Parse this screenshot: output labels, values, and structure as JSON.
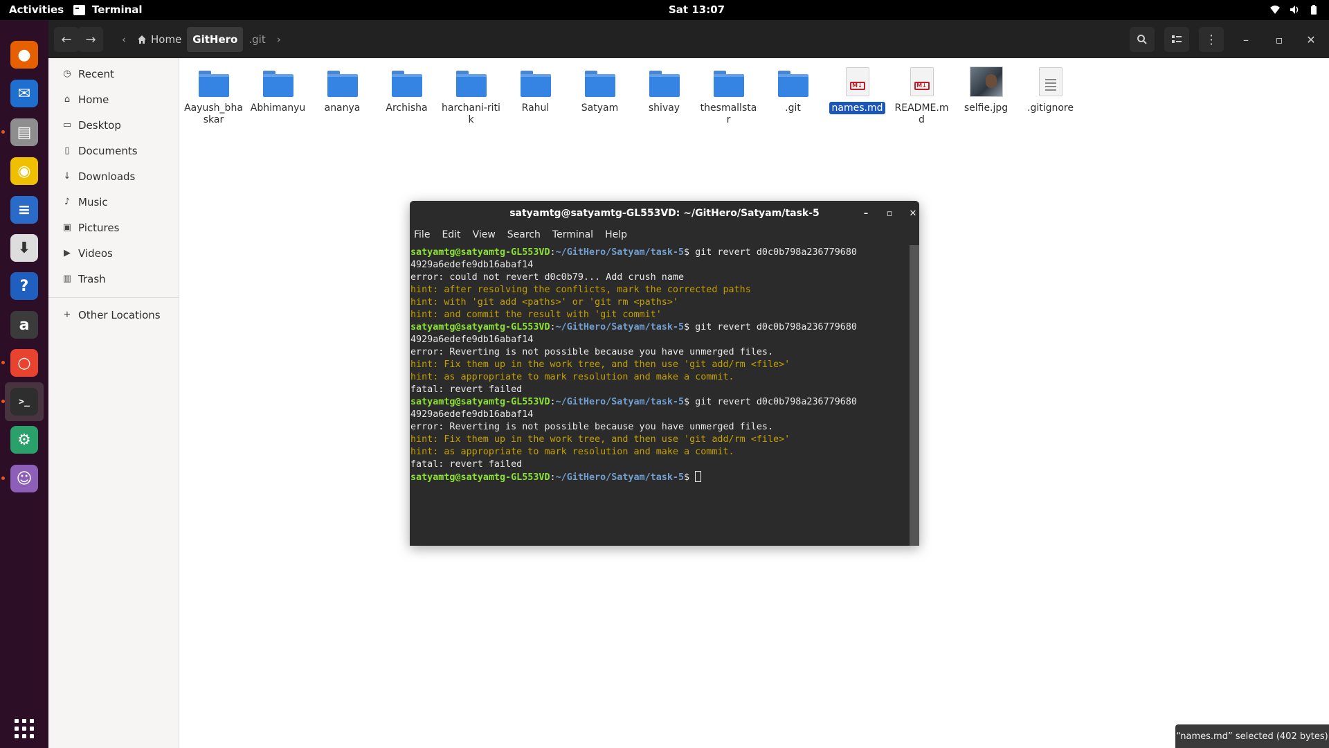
{
  "topbar": {
    "activities": "Activities",
    "app_name": "Terminal",
    "clock": "Sat 13:07"
  },
  "dock": {
    "items": [
      {
        "name": "firefox",
        "icon": "firefox-icon",
        "color": "#e66000"
      },
      {
        "name": "thunderbird",
        "icon": "thunderbird-icon",
        "color": "#1f6fd1"
      },
      {
        "name": "files",
        "icon": "files-icon",
        "color": "#8e8e8e"
      },
      {
        "name": "rhythmbox",
        "icon": "rhythmbox-icon",
        "color": "#f0c000"
      },
      {
        "name": "writer",
        "icon": "writer-icon",
        "color": "#2a6bc9"
      },
      {
        "name": "software",
        "icon": "software-icon",
        "color": "#dddddd"
      },
      {
        "name": "help",
        "icon": "help-icon",
        "color": "#1e5fbf"
      },
      {
        "name": "amazon",
        "icon": "amazon-icon",
        "color": "#3b3b3b"
      },
      {
        "name": "startup-disk",
        "icon": "startup-disk-icon",
        "color": "#e8432e"
      },
      {
        "name": "terminal",
        "icon": "terminal-icon",
        "color": "#2e2e2e"
      },
      {
        "name": "settings",
        "icon": "settings-icon",
        "color": "#2aa06a"
      },
      {
        "name": "gitkraken",
        "icon": "purple-app-icon",
        "color": "#8e5fb8"
      }
    ]
  },
  "files": {
    "path": [
      "Home",
      "GitHero",
      ".git"
    ],
    "sidebar": [
      {
        "label": "Recent",
        "icon": "clock-icon"
      },
      {
        "label": "Home",
        "icon": "home-icon"
      },
      {
        "label": "Desktop",
        "icon": "desktop-icon"
      },
      {
        "label": "Documents",
        "icon": "documents-icon"
      },
      {
        "label": "Downloads",
        "icon": "download-icon"
      },
      {
        "label": "Music",
        "icon": "music-icon"
      },
      {
        "label": "Pictures",
        "icon": "pictures-icon"
      },
      {
        "label": "Videos",
        "icon": "videos-icon"
      },
      {
        "label": "Trash",
        "icon": "trash-icon"
      }
    ],
    "other_locations": "Other Locations",
    "items": [
      {
        "label": "Aayush_bhaskar",
        "type": "folder"
      },
      {
        "label": "Abhimanyu",
        "type": "folder"
      },
      {
        "label": "ananya",
        "type": "folder"
      },
      {
        "label": "Archisha",
        "type": "folder"
      },
      {
        "label": "harchani-ritik",
        "type": "folder"
      },
      {
        "label": "Rahul",
        "type": "folder"
      },
      {
        "label": "Satyam",
        "type": "folder"
      },
      {
        "label": "shivay",
        "type": "folder"
      },
      {
        "label": "thesmallstar",
        "type": "folder"
      },
      {
        "label": ".git",
        "type": "folder"
      },
      {
        "label": "names.md",
        "type": "markdown",
        "selected": true
      },
      {
        "label": "README.md",
        "type": "markdown"
      },
      {
        "label": "selfie.jpg",
        "type": "image"
      },
      {
        "label": ".gitignore",
        "type": "text"
      }
    ],
    "status": "“names.md” selected  (402 bytes)"
  },
  "terminal": {
    "title": "satyamtg@satyamtg-GL553VD: ~/GitHero/Satyam/task-5",
    "menu": [
      "File",
      "Edit",
      "View",
      "Search",
      "Terminal",
      "Help"
    ],
    "prompt_user": "satyamtg@satyamtg-GL553VD",
    "prompt_path": "~/GitHero/Satyam/task-5",
    "lines": [
      {
        "kind": "prompt",
        "cmd": "git revert d0c0b798a236779680"
      },
      {
        "kind": "out",
        "text": "4929a6edefe9db16abaf14"
      },
      {
        "kind": "out",
        "text": "error: could not revert d0c0b79... Add crush name"
      },
      {
        "kind": "hint",
        "text": "hint: after resolving the conflicts, mark the corrected paths"
      },
      {
        "kind": "hint",
        "text": "hint: with 'git add <paths>' or 'git rm <paths>'"
      },
      {
        "kind": "hint",
        "text": "hint: and commit the result with 'git commit'"
      },
      {
        "kind": "prompt",
        "cmd": "git revert d0c0b798a236779680"
      },
      {
        "kind": "out",
        "text": "4929a6edefe9db16abaf14"
      },
      {
        "kind": "out",
        "text": "error: Reverting is not possible because you have unmerged files."
      },
      {
        "kind": "hint",
        "text": "hint: Fix them up in the work tree, and then use 'git add/rm <file>'"
      },
      {
        "kind": "hint",
        "text": "hint: as appropriate to mark resolution and make a commit."
      },
      {
        "kind": "out",
        "text": "fatal: revert failed"
      },
      {
        "kind": "prompt",
        "cmd": "git revert d0c0b798a236779680"
      },
      {
        "kind": "out",
        "text": "4929a6edefe9db16abaf14"
      },
      {
        "kind": "out",
        "text": "error: Reverting is not possible because you have unmerged files."
      },
      {
        "kind": "hint",
        "text": "hint: Fix them up in the work tree, and then use 'git add/rm <file>'"
      },
      {
        "kind": "hint",
        "text": "hint: as appropriate to mark resolution and make a commit."
      },
      {
        "kind": "out",
        "text": "fatal: revert failed"
      },
      {
        "kind": "prompt",
        "cmd": ""
      }
    ]
  }
}
